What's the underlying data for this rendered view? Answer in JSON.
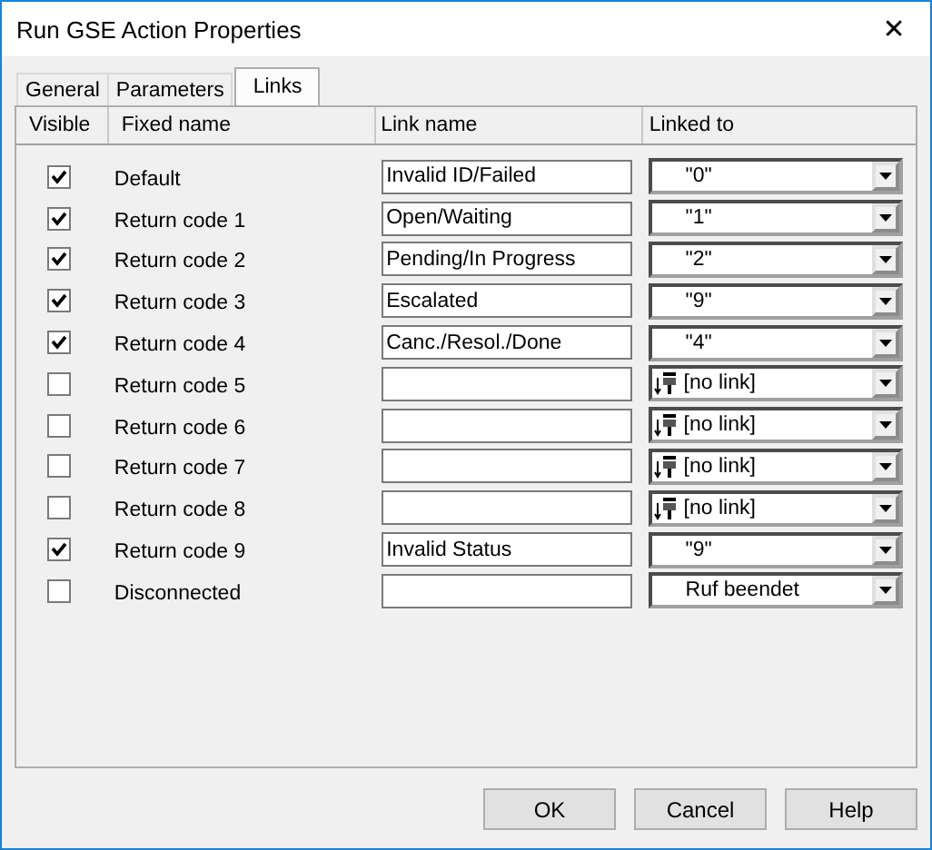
{
  "window": {
    "title": "Run GSE Action Properties",
    "close": "✕"
  },
  "tabs": [
    {
      "label": "General",
      "selected": false
    },
    {
      "label": "Parameters",
      "selected": false
    },
    {
      "label": "Links",
      "selected": true
    }
  ],
  "table": {
    "columns": [
      "Visible",
      "Fixed name",
      "Link name",
      "Linked to"
    ],
    "rows": [
      {
        "visible": true,
        "fixed_name": "Default",
        "link_name": "Invalid ID/Failed",
        "linked_to": {
          "kind": "value",
          "text": "\"0\""
        }
      },
      {
        "visible": true,
        "fixed_name": "Return code 1",
        "link_name": "Open/Waiting",
        "linked_to": {
          "kind": "value",
          "text": "\"1\""
        }
      },
      {
        "visible": true,
        "fixed_name": "Return code 2",
        "link_name": "Pending/In Progress",
        "linked_to": {
          "kind": "value",
          "text": "\"2\""
        }
      },
      {
        "visible": true,
        "fixed_name": "Return code 3",
        "link_name": "Escalated",
        "linked_to": {
          "kind": "value",
          "text": "\"9\""
        }
      },
      {
        "visible": true,
        "fixed_name": "Return code 4",
        "link_name": "Canc./Resol./Done",
        "linked_to": {
          "kind": "value",
          "text": "\"4\""
        }
      },
      {
        "visible": false,
        "fixed_name": "Return code 5",
        "linked_to": {
          "kind": "no_link",
          "text": "[no link]"
        }
      },
      {
        "visible": false,
        "fixed_name": "Return code 6",
        "linked_to": {
          "kind": "no_link",
          "text": "[no link]"
        }
      },
      {
        "visible": false,
        "fixed_name": "Return code 7",
        "linked_to": {
          "kind": "no_link",
          "text": "[no link]"
        }
      },
      {
        "visible": false,
        "fixed_name": "Return code 8",
        "linked_to": {
          "kind": "no_link",
          "text": "[no link]"
        }
      },
      {
        "visible": true,
        "fixed_name": "Return code 9",
        "link_name": "Invalid Status",
        "linked_to": {
          "kind": "value",
          "text": "\"9\""
        }
      },
      {
        "visible": false,
        "fixed_name": "Disconnected",
        "linked_to": {
          "kind": "value",
          "text": "Ruf beendet"
        }
      }
    ]
  },
  "buttons": [
    "OK",
    "Cancel",
    "Help"
  ]
}
